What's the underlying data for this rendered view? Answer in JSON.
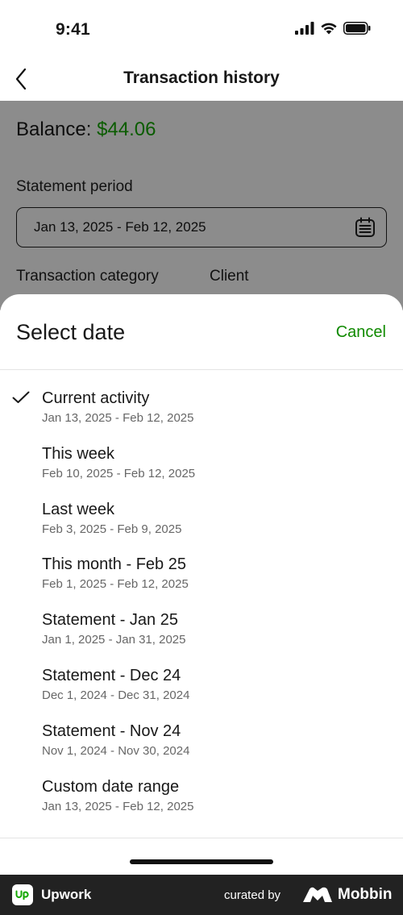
{
  "status_bar": {
    "time": "9:41",
    "icons": [
      "signal-icon",
      "wifi-icon",
      "battery-icon"
    ]
  },
  "header": {
    "title": "Transaction history",
    "back_icon": "chevron-left-icon"
  },
  "background": {
    "balance_label": "Balance: ",
    "balance_amount": "$44.06",
    "statement_period_label": "Statement period",
    "statement_period_value": "Jan 13, 2025 - Feb 12, 2025",
    "calendar_icon": "calendar-icon",
    "transaction_category_label": "Transaction category",
    "client_label": "Client"
  },
  "sheet": {
    "title": "Select date",
    "cancel_label": "Cancel",
    "options": [
      {
        "label": "Current activity",
        "range": "Jan 13, 2025 - Feb 12, 2025",
        "selected": true
      },
      {
        "label": "This week",
        "range": "Feb 10, 2025 - Feb 12, 2025",
        "selected": false
      },
      {
        "label": "Last week",
        "range": "Feb 3, 2025 - Feb 9, 2025",
        "selected": false
      },
      {
        "label": "This month - Feb 25",
        "range": "Feb 1, 2025 - Feb 12, 2025",
        "selected": false
      },
      {
        "label": "Statement - Jan 25",
        "range": "Jan 1, 2025 - Jan 31, 2025",
        "selected": false
      },
      {
        "label": "Statement - Dec 24",
        "range": "Dec 1, 2024 - Dec 31, 2024",
        "selected": false
      },
      {
        "label": "Statement - Nov 24",
        "range": "Nov 1, 2024 - Nov 30, 2024",
        "selected": false
      },
      {
        "label": "Custom date range",
        "range": "Jan 13, 2025 - Feb 12, 2025",
        "selected": false
      }
    ]
  },
  "footer": {
    "app_name": "Upwork",
    "curated_by": "curated by",
    "brand": "Mobbin"
  },
  "colors": {
    "accent_green": "#14a800",
    "cancel_green": "#108a00",
    "overlay": "rgba(0,0,0,0.45)",
    "footer_bg": "#222222"
  }
}
